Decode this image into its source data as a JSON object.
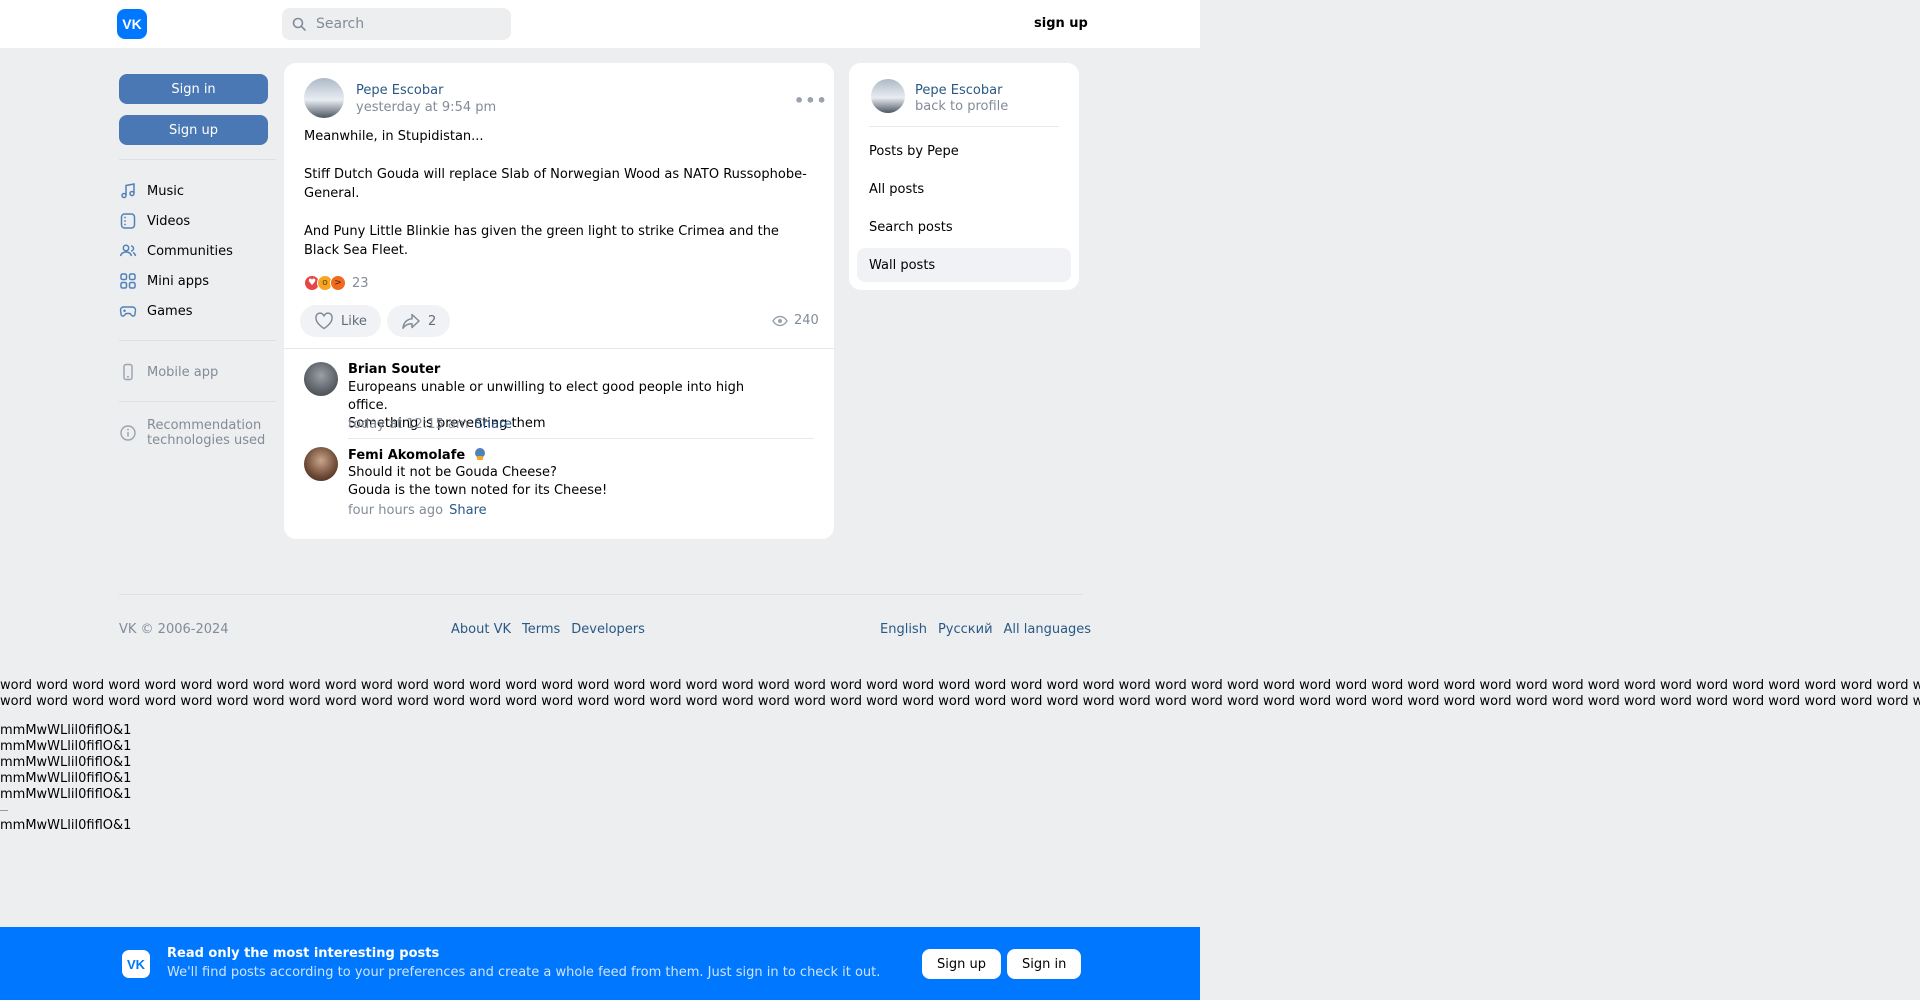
{
  "header": {
    "logo_text": "VK",
    "search_placeholder": "Search",
    "signup_label": "sign up"
  },
  "leftnav": {
    "signin_label": "Sign in",
    "signup_label": "Sign up",
    "items": [
      {
        "label": "Music",
        "icon": "music-icon"
      },
      {
        "label": "Videos",
        "icon": "video-icon"
      },
      {
        "label": "Communities",
        "icon": "users-icon"
      },
      {
        "label": "Mini apps",
        "icon": "grid-icon"
      },
      {
        "label": "Games",
        "icon": "gamepad-icon"
      }
    ],
    "mobile_app": "Mobile app",
    "recommendation_line1": "Recommendation",
    "recommendation_line2": "technologies used"
  },
  "post": {
    "author": "Pepe Escobar",
    "time": "yesterday at 9:54 pm",
    "paragraphs": [
      "Meanwhile, in Stupidistan...",
      "Stiff Dutch Gouda will replace Slab of Norwegian Wood as NATO Russophobe-General.",
      "And Puny Little Blinkie has given the green light to strike Crimea and the Black Sea Fleet."
    ],
    "reactions_count": "23",
    "like_label": "Like",
    "share_count": "2",
    "views": "240",
    "comments": [
      {
        "name": "Brian Souter",
        "lines": [
          "Europeans unable or unwilling to elect good people into high office.",
          "Something is preventing them"
        ],
        "time": "today at 12:15 am",
        "share": "Share"
      },
      {
        "name": "Femi Akomolafe",
        "lines": [
          "Should it not be Gouda Cheese?",
          "Gouda is the town noted for its Cheese!"
        ],
        "time": "four hours ago",
        "share": "Share"
      }
    ]
  },
  "side": {
    "name": "Pepe Escobar",
    "back": "back to profile",
    "menu": [
      "Posts by Pepe",
      "All posts",
      "Search posts",
      "Wall posts"
    ]
  },
  "footer": {
    "copyright": "VK © 2006-2024",
    "links": [
      "About VK",
      "Terms",
      "Developers"
    ],
    "languages": [
      "English",
      "Русский",
      "All languages"
    ]
  },
  "filler": {
    "word": "word",
    "glyphs": "mmMwWLlil0fiflO&1"
  },
  "banner": {
    "logo_text": "VK",
    "title": "Read only the most interesting posts",
    "subtitle": "We'll find posts according to your preferences and create a whole feed from them. Just sign in to check it out.",
    "signup_label": "Sign up",
    "signin_label": "Sign in"
  },
  "colors": {
    "brand": "#0077ff",
    "button": "#4a78b4",
    "link": "#2a5885",
    "background": "#edeef0"
  }
}
